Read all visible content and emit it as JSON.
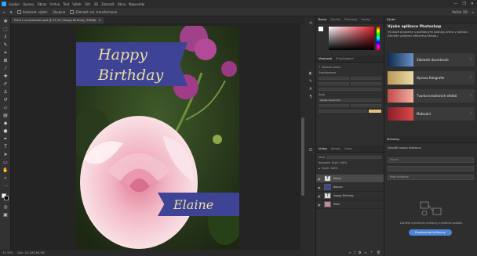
{
  "menu": {
    "items": [
      "Soubor",
      "Úpravy",
      "Obraz",
      "Vrstva",
      "Text",
      "Výběr",
      "Filtr",
      "3D",
      "Zobrazit",
      "Okno",
      "Nápověda"
    ],
    "window_controls": [
      "—",
      "❐",
      "✕"
    ]
  },
  "options": {
    "auto_select_label": "Automat. výběr:",
    "auto_select_value": "Skupina",
    "transform_label": "Zobrazit ovl. transformace",
    "mode_3d": "Režim 3D:"
  },
  "document": {
    "tab_title": "Přání k narozeninám.psd @ 33,3% (Happy Birthday, RGB/8)",
    "close": "×"
  },
  "card": {
    "line1": "Happy",
    "line2": "Birthday",
    "name": "Elaine"
  },
  "status": {
    "zoom": "33,33%",
    "info": "Dok: 24,1M/164,3M"
  },
  "panels": {
    "top_tabs": [
      "Barva",
      "Vzorník",
      "Přechody",
      "Vzorky"
    ],
    "props_tabs": [
      "Vlastnosti",
      "Přizpůsobení"
    ],
    "props_title": "Textová vrstva",
    "transform_label": "Transformace",
    "character_label": "Znak",
    "font_value": "Adobe Caslon Pro",
    "layers_tabs": [
      "Vrstvy",
      "Kanály",
      "Cesty"
    ],
    "layers_kind": "Druh",
    "blend": "Normální",
    "opacity": "Krytí: 100%",
    "fill": "Výplň: 100%",
    "layers": [
      {
        "name": "Elaine"
      },
      {
        "name": "Banner"
      },
      {
        "name": "Happy Birthday"
      },
      {
        "name": "Růže"
      }
    ]
  },
  "learn": {
    "tab": "Výuka",
    "title": "Výuka aplikace Photoshop",
    "subtitle": "Výukové programy s podrobnými postupy přímo v aplikaci. Začněte výběrem některého tématu.",
    "items": [
      {
        "label": "Základní dovednosti"
      },
      {
        "label": "Oprava fotografie"
      },
      {
        "label": "Tvorba kreativních efektů"
      },
      {
        "label": "Malování"
      }
    ]
  },
  "libraries": {
    "tab": "Knihovny",
    "create": "Vytvořit novou knihovnu",
    "search": "Hledat",
    "list_label": "Moje knihovny",
    "empty_text": "Začněte vytvořením knihovny a přidáním položek.",
    "button": "Prozkoumat knihovny"
  },
  "colors": {
    "accent": "#31a8ff",
    "banner": "#3f4396",
    "banner_text": "#e8dfa0"
  }
}
